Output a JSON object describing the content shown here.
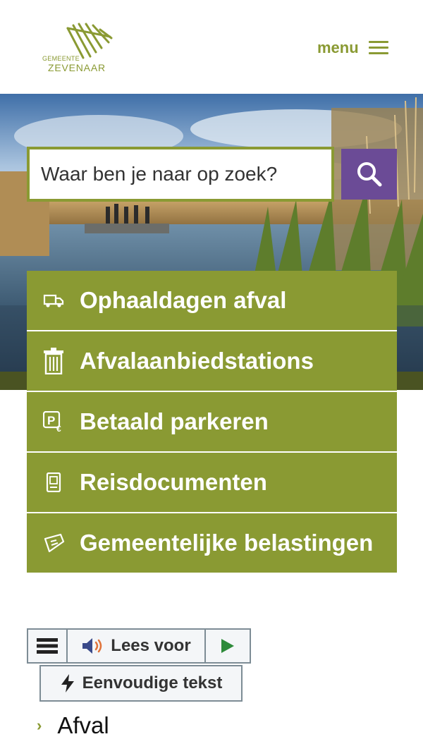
{
  "header": {
    "logo": {
      "small_text": "GEMEENTE",
      "big_text": "ZEVENAAR",
      "icon": "logo-mark"
    },
    "menu_label": "menu",
    "menu_icon": "hamburger-icon"
  },
  "search": {
    "placeholder": "Waar ben je naar op zoek?",
    "button_icon": "search-icon"
  },
  "tiles": [
    {
      "label": "Ophaaldagen afval",
      "icon": "garbage-truck-icon"
    },
    {
      "label": "Afvalaanbiedstations",
      "icon": "trash-bin-icon"
    },
    {
      "label": "Betaald parkeren",
      "icon": "parking-euro-icon"
    },
    {
      "label": "Reisdocumenten",
      "icon": "passport-icon"
    },
    {
      "label": "Gemeentelijke belastingen",
      "icon": "tax-ticket-icon"
    }
  ],
  "readspeaker": {
    "menu_icon": "menu-icon",
    "listen_label": "Lees voor",
    "listen_icon": "speaker-icon",
    "play_icon": "play-icon",
    "simple_label": "Eenvoudige tekst",
    "simple_icon": "lightning-icon"
  },
  "breadcrumb": {
    "label": "Afval",
    "icon": "chevron-right-icon"
  },
  "colors": {
    "brand_green": "#8a9a33",
    "brand_purple": "#6b4b96",
    "dark_band": "#4a5322",
    "text": "#111111"
  }
}
